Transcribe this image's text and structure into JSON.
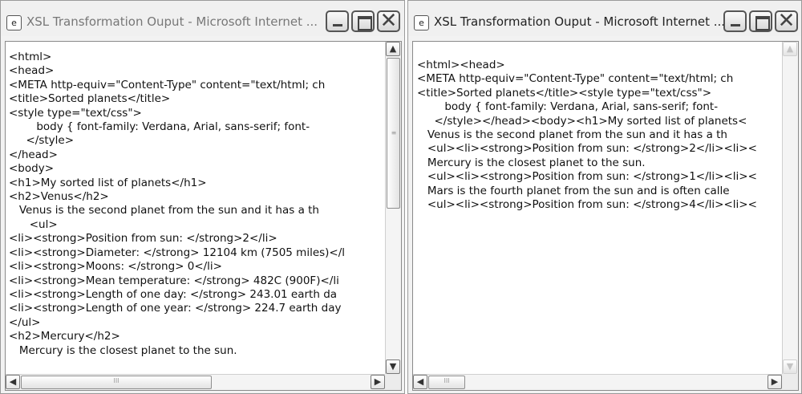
{
  "windows": [
    {
      "title": "XSL Transformation Ouput - Microsoft Internet ...",
      "app_icon_glyph": "e",
      "controls": {
        "minimize": "minimize",
        "maximize": "maximize",
        "close": "close"
      },
      "lines": [
        "<html>",
        "<head>",
        "<META http-equiv=\"Content-Type\" content=\"text/html; ch",
        "<title>Sorted planets</title>",
        "<style type=\"text/css\">",
        "        body { font-family: Verdana, Arial, sans-serif; font-",
        "     </style>",
        "</head>",
        "<body>",
        "<h1>My sorted list of planets</h1>",
        "<h2>Venus</h2>",
        "   Venus is the second planet from the sun and it has a th",
        "      <ul>",
        "<li><strong>Position from sun: </strong>2</li>",
        "<li><strong>Diameter: </strong> 12104 km (7505 miles)</l",
        "<li><strong>Moons: </strong> 0</li>",
        "<li><strong>Mean temperature: </strong> 482C (900F)</li",
        "<li><strong>Length of one day: </strong> 243.01 earth da",
        "<li><strong>Length of one year: </strong> 224.7 earth day",
        "</ul>",
        "<h2>Mercury</h2>",
        "   Mercury is the closest planet to the sun."
      ],
      "scroll": {
        "up": "▲",
        "down": "▼",
        "left": "◀",
        "right": "▶",
        "grip": "≡",
        "hgrip": "III"
      }
    },
    {
      "title": "XSL Transformation Ouput - Microsoft Internet ...",
      "app_icon_glyph": "e",
      "controls": {
        "minimize": "minimize",
        "maximize": "maximize",
        "close": "close"
      },
      "lines": [
        "<html><head>",
        "<META http-equiv=\"Content-Type\" content=\"text/html; ch",
        "<title>Sorted planets</title><style type=\"text/css\">",
        "        body { font-family: Verdana, Arial, sans-serif; font-",
        "     </style></head><body><h1>My sorted list of planets<",
        "   Venus is the second planet from the sun and it has a th",
        "   <ul><li><strong>Position from sun: </strong>2</li><li><",
        "   Mercury is the closest planet to the sun.",
        "   <ul><li><strong>Position from sun: </strong>1</li><li><",
        "   Mars is the fourth planet from the sun and is often calle",
        "   <ul><li><strong>Position from sun: </strong>4</li><li><"
      ],
      "scroll": {
        "up": "▲",
        "down": "▼",
        "left": "◀",
        "right": "▶",
        "hgrip": "III"
      }
    }
  ]
}
